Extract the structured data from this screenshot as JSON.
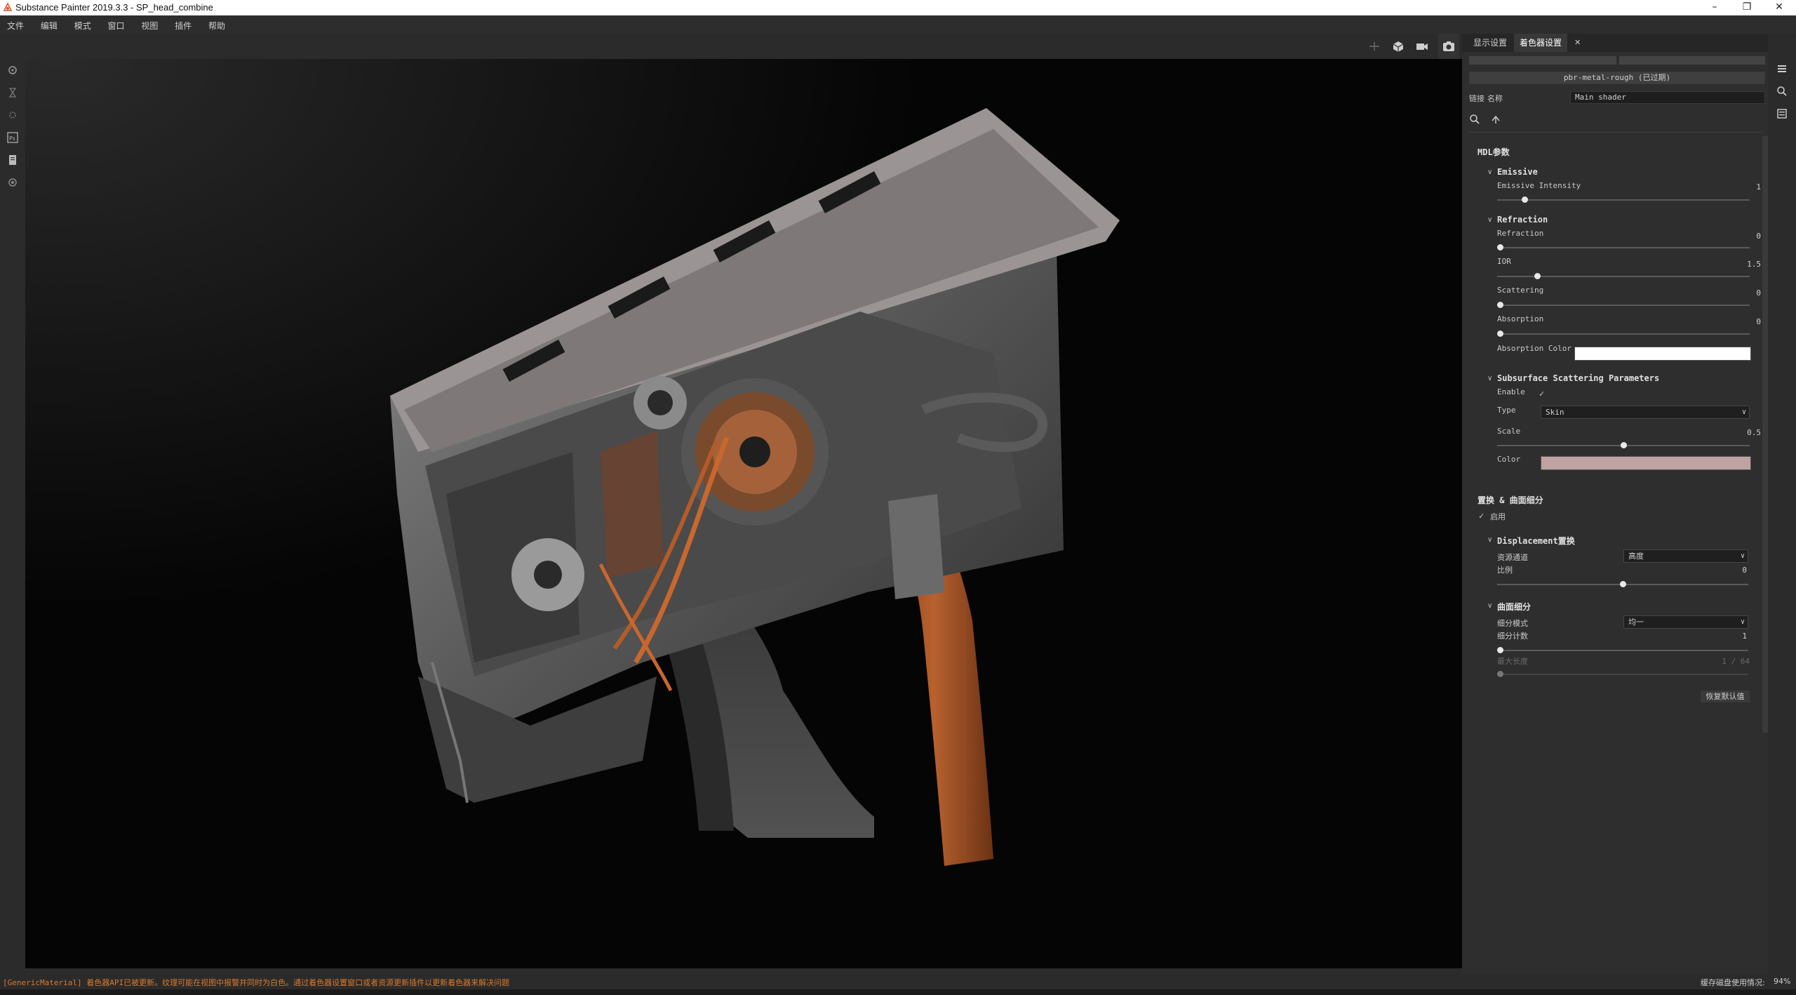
{
  "window": {
    "title": "Substance Painter 2019.3.3 - SP_head_combine",
    "minimize": "–",
    "maximize": "❐",
    "close": "✕"
  },
  "menu": [
    "文件",
    "编辑",
    "模式",
    "窗口",
    "视图",
    "插件",
    "帮助"
  ],
  "left_toolbar_icons": [
    "settings-icon",
    "hourglass-icon",
    "gear-icon",
    "photoshop-icon",
    "document-icon",
    "cog-icon"
  ],
  "viewport_toolbar_icons": [
    "axis-icon",
    "cube-icon",
    "camera-icon",
    "screenshot-icon"
  ],
  "panel": {
    "tabs": [
      {
        "label": "显示设置"
      },
      {
        "label": "着色器设置"
      }
    ],
    "tab_close": "✕",
    "top_buttons": [
      "",
      ""
    ],
    "shader_button": "pbr-metal-rough (已过期)",
    "link_label": "链接",
    "name_label": "名称",
    "name_value": "Main shader",
    "section_title": "MDL参数",
    "emissive": {
      "header": "Emissive",
      "intensity_label": "Emissive Intensity",
      "intensity_value": "1",
      "intensity_level": 0.1
    },
    "refraction": {
      "header": "Refraction",
      "refraction_label": "Refraction",
      "refraction_value": "0",
      "refraction_level": 0.0,
      "ior_label": "IOR",
      "ior_value": "1.5",
      "ior_level": 0.15,
      "scattering_label": "Scattering",
      "scattering_value": "0",
      "scattering_level": 0.0,
      "absorption_label": "Absorption",
      "absorption_value": "0",
      "absorption_level": 0.0,
      "absorption_color_label": "Absorption Color",
      "absorption_color": "#ffffff"
    },
    "sss": {
      "header": "Subsurface Scattering Parameters",
      "enable_label": "Enable",
      "enable_check": "✓",
      "type_label": "Type",
      "type_value": "Skin",
      "scale_label": "Scale",
      "scale_value": "0.5",
      "scale_level": 0.5,
      "color_label": "Color",
      "color_value": "#bfa3a0"
    },
    "displacement_section": "置换 & 曲面细分",
    "enable_check": "✓",
    "enable_label": "启用",
    "displacement": {
      "header": "Displacement置换",
      "channel_label": "资源通道",
      "channel_value": "高度",
      "scale_label": "比例",
      "scale_value": "0",
      "scale_level": 0.5
    },
    "tessellation": {
      "header": "曲面细分",
      "mode_label": "细分模式",
      "mode_value": "均一",
      "count_label": "细分计数",
      "count_value": "1",
      "count_level": 0.0,
      "max_label": "最大长度",
      "max_value": "1 / 64",
      "max_level": 0.0
    },
    "reset_button": "恢复默认值"
  },
  "right_rail_icons": [
    "layers-icon",
    "search-icon",
    "properties-icon"
  ],
  "status": {
    "message": "[GenericMaterial] 着色器API已被更新。纹理可能在视图中报警并同时为白色。通过着色器设置窗口或者资源更新插件以更新着色器来解决问题",
    "cache_label": "缓存磁盘使用情况:",
    "cache_value": "94%"
  },
  "colors": {
    "accent": "#e67e22",
    "warning_text": "#d97a2e",
    "panel_bg": "#2e2e2e"
  }
}
